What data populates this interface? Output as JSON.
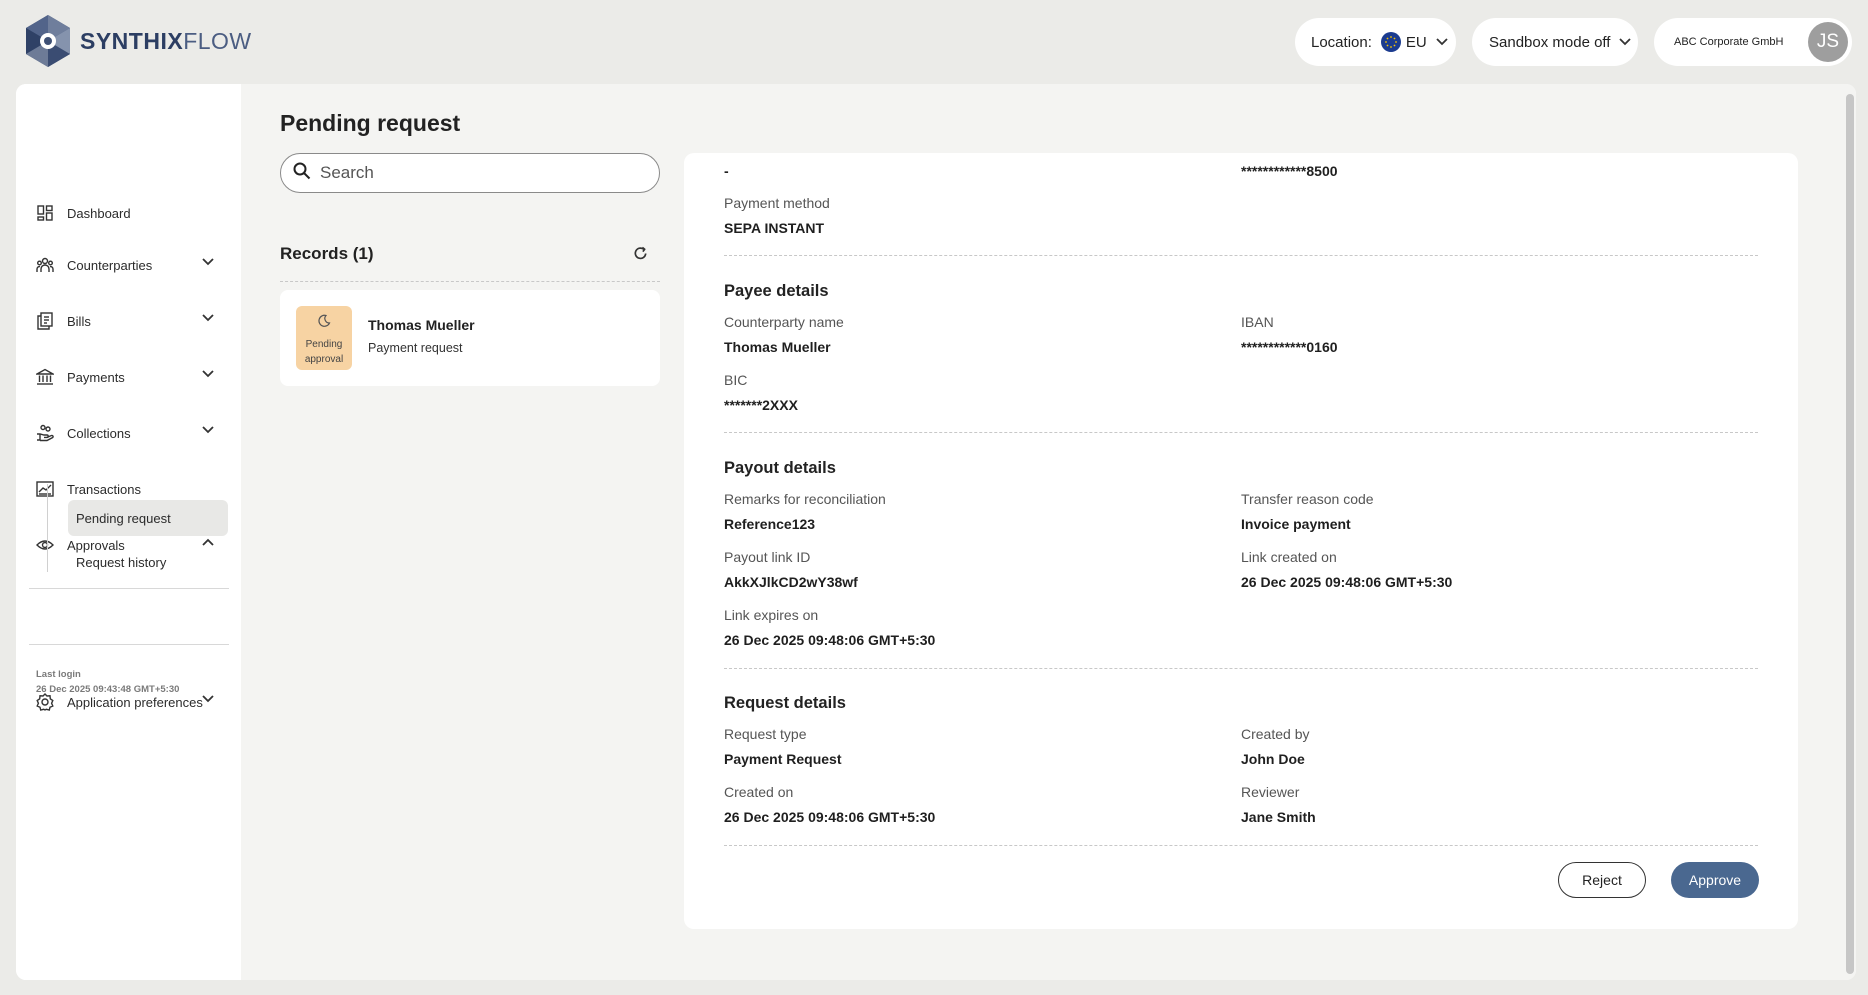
{
  "brand": {
    "name_bold": "SYNTHIX",
    "name_light": "FLOW"
  },
  "topbar": {
    "location_label": "Location:",
    "location_value": "EU",
    "sandbox_label": "Sandbox mode off",
    "company_name": "ABC Corporate GmbH",
    "avatar_initials": "JS"
  },
  "sidebar": {
    "items": [
      {
        "label": "Dashboard",
        "icon": "grid-icon"
      },
      {
        "label": "Counterparties",
        "icon": "people-icon"
      },
      {
        "label": "Bills",
        "icon": "document-icon"
      },
      {
        "label": "Payments",
        "icon": "bank-icon"
      },
      {
        "label": "Collections",
        "icon": "hand-coins-icon"
      },
      {
        "label": "Transactions",
        "icon": "chart-icon"
      },
      {
        "label": "Approvals",
        "icon": "eye-icon"
      },
      {
        "label": "Application preferences",
        "icon": "gear-icon"
      }
    ],
    "approvals_sub": [
      "Pending request",
      "Request history"
    ],
    "last_login_label": "Last login",
    "last_login_value": "26 Dec 2025 09:43:48 GMT+5:30"
  },
  "page": {
    "title": "Pending request",
    "search_placeholder": "Search",
    "records_title": "Records (1)"
  },
  "record": {
    "status_line1": "Pending",
    "status_line2": "approval",
    "name": "Thomas Mueller",
    "type": "Payment request"
  },
  "details": {
    "top": {
      "left_value": "-",
      "right_value": "************8500"
    },
    "payment_method": {
      "label": "Payment method",
      "value": "SEPA INSTANT"
    },
    "payee": {
      "title": "Payee details",
      "counterparty_label": "Counterparty name",
      "counterparty_value": "Thomas Mueller",
      "iban_label": "IBAN",
      "iban_value": "************0160",
      "bic_label": "BIC",
      "bic_value": "*******2XXX"
    },
    "payout": {
      "title": "Payout details",
      "remarks_label": "Remarks for reconciliation",
      "remarks_value": "Reference123",
      "reason_label": "Transfer reason code",
      "reason_value": "Invoice payment",
      "link_id_label": "Payout link ID",
      "link_id_value": "AkkXJlkCD2wY38wf",
      "created_label": "Link created on",
      "created_value": "26 Dec 2025 09:48:06 GMT+5:30",
      "expires_label": "Link expires on",
      "expires_value": "26 Dec 2025 09:48:06 GMT+5:30"
    },
    "request": {
      "title": "Request details",
      "type_label": "Request type",
      "type_value": "Payment Request",
      "created_by_label": "Created by",
      "created_by_value": "John Doe",
      "created_on_label": "Created on",
      "created_on_value": "26 Dec 2025 09:48:06 GMT+5:30",
      "reviewer_label": "Reviewer",
      "reviewer_value": "Jane Smith"
    },
    "actions": {
      "reject": "Reject",
      "approve": "Approve"
    }
  },
  "colors": {
    "brand_navy": "#2c3e63",
    "approve_button": "#4a6890",
    "pending_badge": "#f7d3a3",
    "app_background": "#ebebe8"
  }
}
